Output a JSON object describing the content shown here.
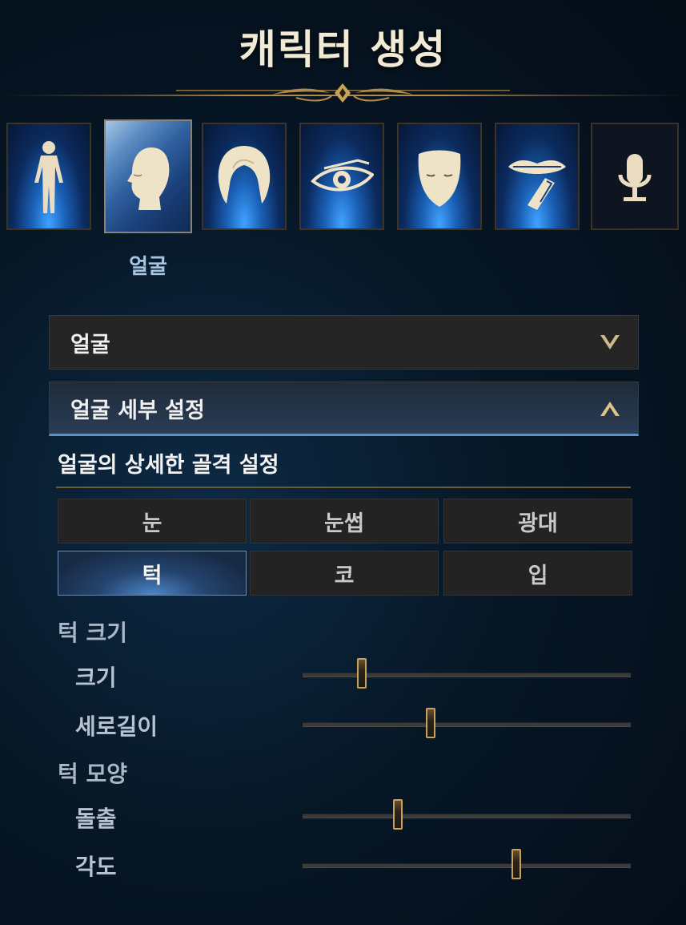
{
  "header": {
    "title": "캐릭터 생성"
  },
  "tabs": [
    {
      "icon": "body-icon",
      "selected": false
    },
    {
      "icon": "face-icon",
      "selected": true,
      "label": "얼굴"
    },
    {
      "icon": "hair-icon",
      "selected": false
    },
    {
      "icon": "eye-icon",
      "selected": false
    },
    {
      "icon": "mask-icon",
      "selected": false
    },
    {
      "icon": "lips-icon",
      "selected": false
    },
    {
      "icon": "microphone-icon",
      "selected": false
    }
  ],
  "accordions": [
    {
      "label": "얼굴",
      "state": "collapsed",
      "chevron": "chevron-down-icon"
    },
    {
      "label": "얼굴 세부 설정",
      "state": "expanded",
      "chevron": "chevron-up-icon"
    }
  ],
  "section": {
    "description": "얼굴의 상세한 골격 설정"
  },
  "parts": [
    {
      "label": "눈",
      "selected": false
    },
    {
      "label": "눈썹",
      "selected": false
    },
    {
      "label": "광대",
      "selected": false
    },
    {
      "label": "턱",
      "selected": true
    },
    {
      "label": "코",
      "selected": false
    },
    {
      "label": "입",
      "selected": false
    }
  ],
  "groups": [
    {
      "title": "턱 크기",
      "sliders": [
        {
          "label": "크기",
          "value": 0.18
        },
        {
          "label": "세로길이",
          "value": 0.39
        }
      ]
    },
    {
      "title": "턱 모양",
      "sliders": [
        {
          "label": "돌출",
          "value": 0.29
        },
        {
          "label": "각도",
          "value": 0.65
        }
      ]
    }
  ],
  "colors": {
    "accent_gold": "#c9a25a",
    "accent_blue": "#5a8fce",
    "title": "#f3ead4"
  }
}
